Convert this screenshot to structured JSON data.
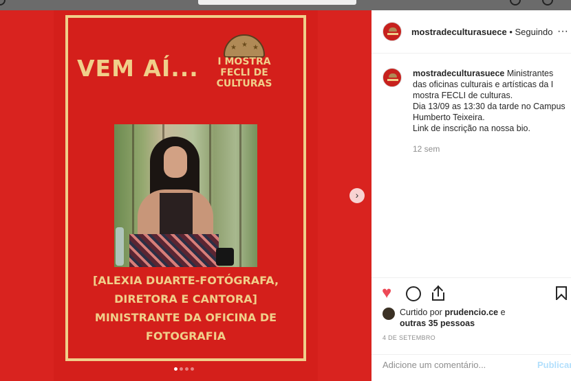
{
  "colors": {
    "poster_red": "#d41f1b",
    "poster_gold": "#f0cf8a",
    "like_red": "#ed4956",
    "muted_text": "#8e8e8e",
    "publish_blue": "#b2dffc"
  },
  "post_image": {
    "headline": "VEM AÍ...",
    "logo_lines": [
      "I MOSTRA",
      "FECLI DE",
      "CULTURAS"
    ],
    "caption_lines": [
      "[ALEXIA DUARTE-FOTÓGRAFA,",
      "DIRETORA E CANTORA]",
      "MINISTRANTE DA OFICINA DE",
      "FOTOGRAFIA"
    ],
    "next_icon": "chevron-right-icon",
    "carousel": {
      "count": 4,
      "active": 1
    }
  },
  "header": {
    "username": "mostradeculturasuece",
    "separator": " • ",
    "follow_status": "Seguindo",
    "more_icon": "ellipsis-icon",
    "more_glyph": "···"
  },
  "comment": {
    "username": "mostradeculturasuece",
    "text_lines": [
      " Ministrantes das oficinas culturais e artísticas da I mostra FECLI de culturas.",
      "Dia 13/09 as 13:30 da tarde no Campus Humberto Teixeira.",
      "Link de inscrição na nossa bio."
    ],
    "time": "12 sem"
  },
  "actions": {
    "like_icon": "heart-icon",
    "comment_icon": "comment-bubble-icon",
    "share_icon": "share-icon",
    "save_icon": "bookmark-icon",
    "heart_glyph": "♥"
  },
  "likes": {
    "prefix": "Curtido por ",
    "user": "prudencio.ce",
    "middle": " e",
    "others": "outras 35 pessoas"
  },
  "date": "4 DE SETEMBRO",
  "add_comment": {
    "placeholder": "Adicione um comentário...",
    "publish": "Publicar"
  }
}
